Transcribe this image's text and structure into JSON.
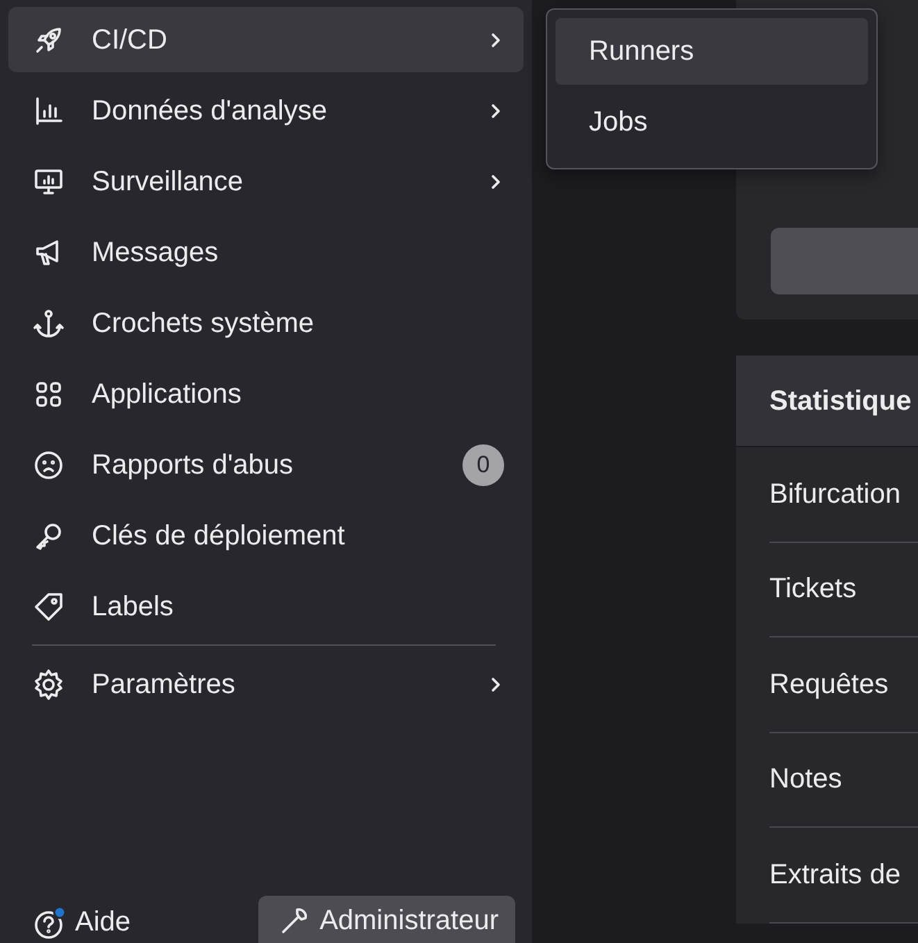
{
  "sidebar": {
    "items": [
      {
        "label": "CI/CD",
        "has_submenu": true,
        "selected": true
      },
      {
        "label": "Données d'analyse",
        "has_submenu": true,
        "selected": false
      },
      {
        "label": "Surveillance",
        "has_submenu": true,
        "selected": false
      },
      {
        "label": "Messages",
        "has_submenu": false,
        "selected": false
      },
      {
        "label": "Crochets système",
        "has_submenu": false,
        "selected": false
      },
      {
        "label": "Applications",
        "has_submenu": false,
        "selected": false
      },
      {
        "label": "Rapports d'abus",
        "has_submenu": false,
        "selected": false,
        "badge": "0"
      },
      {
        "label": "Clés de déploiement",
        "has_submenu": false,
        "selected": false
      },
      {
        "label": "Labels",
        "has_submenu": false,
        "selected": false
      }
    ],
    "settings": {
      "label": "Paramètres",
      "has_submenu": true,
      "selected": false
    },
    "help": {
      "label": "Aide",
      "notification": true
    },
    "admin_button": "Administrateur"
  },
  "flyout": {
    "items": [
      {
        "label": "Runners",
        "selected": true
      },
      {
        "label": "Jobs",
        "selected": false
      }
    ]
  },
  "stats": {
    "title": "Statistique",
    "rows": [
      "Bifurcation",
      "Tickets",
      "Requêtes",
      "Notes",
      "Extraits de"
    ]
  }
}
